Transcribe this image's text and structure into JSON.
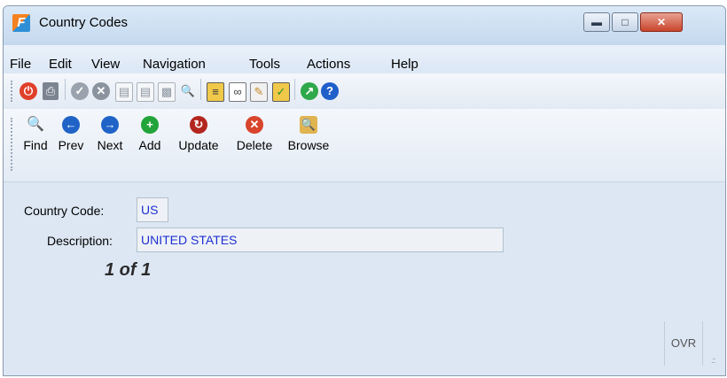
{
  "window": {
    "title": "Country Codes",
    "app_icon_letter": "F"
  },
  "menu": [
    "File",
    "Edit",
    "View",
    "Navigation",
    "Tools",
    "Actions",
    "Help"
  ],
  "toolbar_icons": [
    "power-icon",
    "print-icon",
    "ok-icon",
    "cancel-icon",
    "copy-doc-icon",
    "paste-doc-icon",
    "select-doc-icon",
    "zoom-icon",
    "notes-icon",
    "attachment-icon",
    "report-icon",
    "checklist-icon",
    "chart-icon",
    "help-icon"
  ],
  "nav": {
    "find": "Find",
    "prev": "Prev",
    "next": "Next",
    "add": "Add",
    "update": "Update",
    "delete": "Delete",
    "browse": "Browse"
  },
  "form": {
    "country_code_label": "Country Code:",
    "country_code_value": "US",
    "description_label": "Description:",
    "description_value": "UNITED STATES"
  },
  "record_count": "1 of 1",
  "status": {
    "mode": "OVR"
  },
  "colors": {
    "value_text": "#1f2fd1",
    "find": "#2f6fc4",
    "prev": "#1f63c7",
    "next": "#1f63c7",
    "add": "#22a43a",
    "update": "#b3261e",
    "delete": "#d8442c",
    "browse": "#c48a2b"
  }
}
